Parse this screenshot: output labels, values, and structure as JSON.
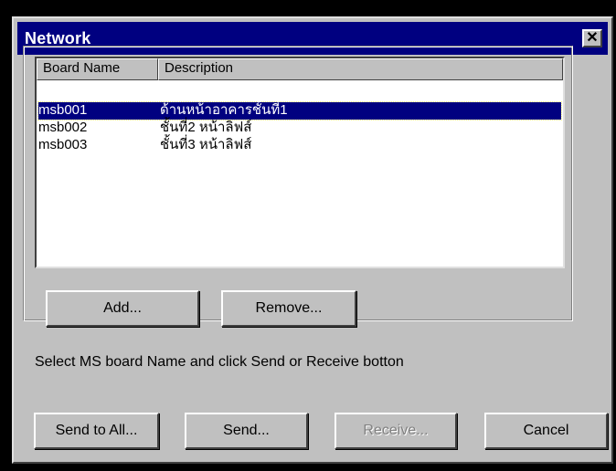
{
  "window": {
    "title": "Network",
    "close_glyph": "✕"
  },
  "list": {
    "columns": [
      "Board Name",
      "Description"
    ],
    "rows": [
      {
        "name": "",
        "description": "",
        "selected": false
      },
      {
        "name": "msb001",
        "description": "ด้านหน้าอาคารชั้นที่1",
        "selected": true
      },
      {
        "name": "msb002",
        "description": "ชั้นที่2 หน้าลิฟส์",
        "selected": false
      },
      {
        "name": "msb003",
        "description": "ชั้นที่3 หน้าลิฟส์",
        "selected": false
      }
    ]
  },
  "group_buttons": {
    "add": "Add...",
    "remove": "Remove..."
  },
  "hint": "Select MS board Name and click Send or Receive botton",
  "footer_buttons": {
    "send_to_all": "Send to All...",
    "send": "Send...",
    "receive": "Receive...",
    "cancel": "Cancel"
  },
  "colors": {
    "titlebar": "#000080",
    "face": "#c0c0c0",
    "selection": "#000080"
  }
}
